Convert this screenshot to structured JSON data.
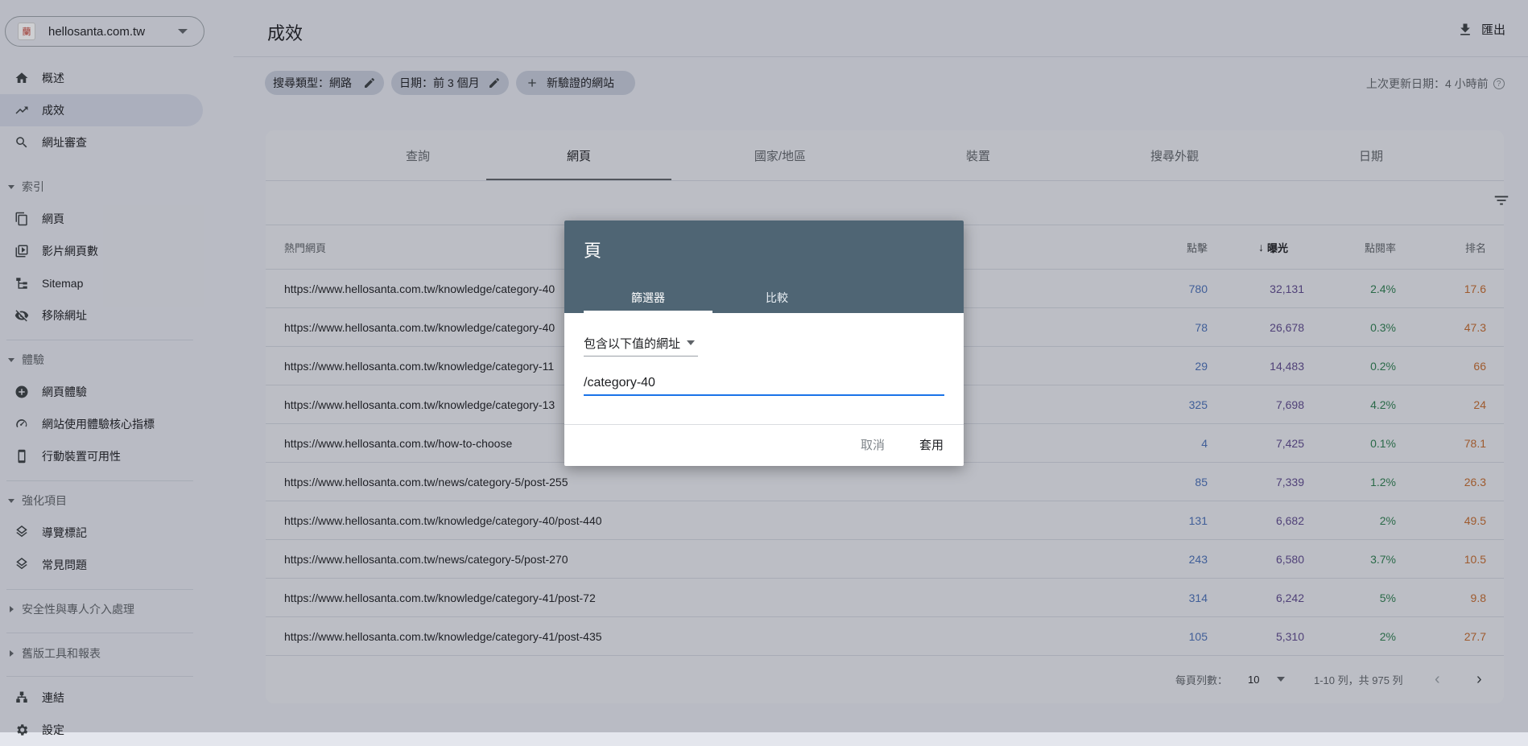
{
  "property": {
    "name": "hellosanta.com.tw",
    "logo_glyph": "蘭"
  },
  "sidebar": {
    "items_top": [
      {
        "label": "概述",
        "icon": "home-icon"
      },
      {
        "label": "成效",
        "icon": "trending-up-icon",
        "active": true
      },
      {
        "label": "網址審查",
        "icon": "search-icon"
      }
    ],
    "section_index": "索引",
    "items_index": [
      {
        "label": "網頁",
        "icon": "pages-icon"
      },
      {
        "label": "影片網頁數",
        "icon": "video-icon"
      },
      {
        "label": "Sitemap",
        "icon": "sitemap-icon"
      },
      {
        "label": "移除網址",
        "icon": "eye-off-icon"
      }
    ],
    "section_experience": "體驗",
    "items_experience": [
      {
        "label": "網頁體驗",
        "icon": "plus-circle-icon"
      },
      {
        "label": "網站使用體驗核心指標",
        "icon": "gauge-icon"
      },
      {
        "label": "行動裝置可用性",
        "icon": "phone-icon"
      }
    ],
    "section_enhance": "強化項目",
    "items_enhance": [
      {
        "label": "導覽標記",
        "icon": "layers-icon"
      },
      {
        "label": "常見問題",
        "icon": "layers-icon"
      }
    ],
    "section_security": "安全性與專人介入處理",
    "section_legacy": "舊版工具和報表",
    "items_bottom": [
      {
        "label": "連結",
        "icon": "links-icon"
      },
      {
        "label": "設定",
        "icon": "settings-icon"
      }
    ]
  },
  "header": {
    "title": "成效",
    "export_label": "匯出",
    "chip_search_type": "搜尋類型：網路",
    "chip_date": "日期：前 3 個月",
    "chip_add": "新驗證的網站",
    "last_update": "上次更新日期：4 小時前"
  },
  "tabs": [
    "查詢",
    "網頁",
    "國家/地區",
    "裝置",
    "搜尋外觀",
    "日期"
  ],
  "table": {
    "headers": {
      "page": "熱門網頁",
      "clicks": "點擊",
      "impressions": "曝光",
      "ctr": "點閱率",
      "position": "排名"
    },
    "rows": [
      {
        "url": "https://www.hellosanta.com.tw/knowledge/category-40",
        "clicks": "780",
        "impressions": "32,131",
        "ctr": "2.4%",
        "position": "17.6"
      },
      {
        "url": "https://www.hellosanta.com.tw/knowledge/category-40",
        "clicks": "78",
        "impressions": "26,678",
        "ctr": "0.3%",
        "position": "47.3"
      },
      {
        "url": "https://www.hellosanta.com.tw/knowledge/category-11",
        "clicks": "29",
        "impressions": "14,483",
        "ctr": "0.2%",
        "position": "66"
      },
      {
        "url": "https://www.hellosanta.com.tw/knowledge/category-13",
        "clicks": "325",
        "impressions": "7,698",
        "ctr": "4.2%",
        "position": "24"
      },
      {
        "url": "https://www.hellosanta.com.tw/how-to-choose",
        "clicks": "4",
        "impressions": "7,425",
        "ctr": "0.1%",
        "position": "78.1"
      },
      {
        "url": "https://www.hellosanta.com.tw/news/category-5/post-255",
        "clicks": "85",
        "impressions": "7,339",
        "ctr": "1.2%",
        "position": "26.3"
      },
      {
        "url": "https://www.hellosanta.com.tw/knowledge/category-40/post-440",
        "clicks": "131",
        "impressions": "6,682",
        "ctr": "2%",
        "position": "49.5"
      },
      {
        "url": "https://www.hellosanta.com.tw/news/category-5/post-270",
        "clicks": "243",
        "impressions": "6,580",
        "ctr": "3.7%",
        "position": "10.5"
      },
      {
        "url": "https://www.hellosanta.com.tw/knowledge/category-41/post-72",
        "clicks": "314",
        "impressions": "6,242",
        "ctr": "5%",
        "position": "9.8"
      },
      {
        "url": "https://www.hellosanta.com.tw/knowledge/category-41/post-435",
        "clicks": "105",
        "impressions": "5,310",
        "ctr": "2%",
        "position": "27.7"
      }
    ]
  },
  "pagination": {
    "rows_per_page_label": "每頁列數：",
    "rows_per_page": "10",
    "range": "1-10 列，共 975 列"
  },
  "dialog": {
    "title": "頁",
    "tab_filter": "篩選器",
    "tab_compare": "比較",
    "match_type": "包含以下值的網址",
    "input_value": "/category-40",
    "cancel": "取消",
    "apply": "套用"
  },
  "colors": {
    "clicks": "#4a6fb5",
    "impressions": "#5e4a8c",
    "ctr": "#2e7d4f",
    "position": "#c26a2e",
    "dialog_header": "#4f6574",
    "accent": "#1a73e8"
  }
}
